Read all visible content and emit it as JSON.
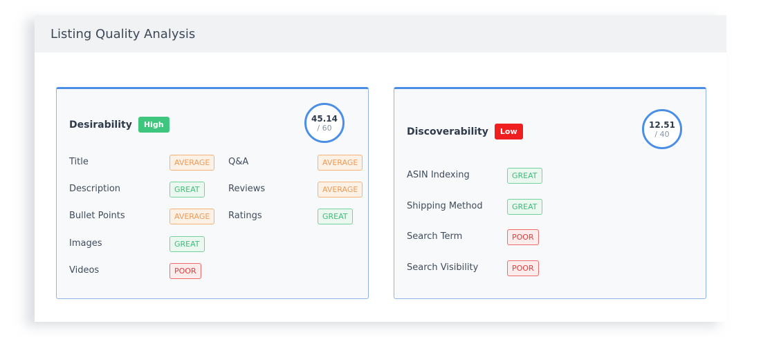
{
  "header": {
    "title": "Listing Quality Analysis"
  },
  "desirability": {
    "title": "Desirability",
    "level": "High",
    "level_color": "#3ec67e",
    "score": "45.14",
    "max": "/ 60",
    "metrics": [
      {
        "label": "Title",
        "status": "AVERAGE"
      },
      {
        "label": "Description",
        "status": "GREAT"
      },
      {
        "label": "Bullet Points",
        "status": "AVERAGE"
      },
      {
        "label": "Images",
        "status": "GREAT"
      },
      {
        "label": "Videos",
        "status": "POOR"
      },
      {
        "label": "Q&A",
        "status": "AVERAGE"
      },
      {
        "label": "Reviews",
        "status": "AVERAGE"
      },
      {
        "label": "Ratings",
        "status": "GREAT"
      }
    ]
  },
  "discoverability": {
    "title": "Discoverability",
    "level": "Low",
    "level_color": "#f01f1f",
    "score": "12.51",
    "max": "/ 40",
    "metrics": [
      {
        "label": "ASIN Indexing",
        "status": "GREAT"
      },
      {
        "label": "Shipping Method",
        "status": "GREAT"
      },
      {
        "label": "Search Term",
        "status": "POOR"
      },
      {
        "label": "Search Visibility",
        "status": "POOR"
      }
    ]
  },
  "colors": {
    "accent": "#4b8ee6",
    "average": "#f09a55",
    "great": "#3cbd78",
    "poor": "#e43b3b"
  }
}
